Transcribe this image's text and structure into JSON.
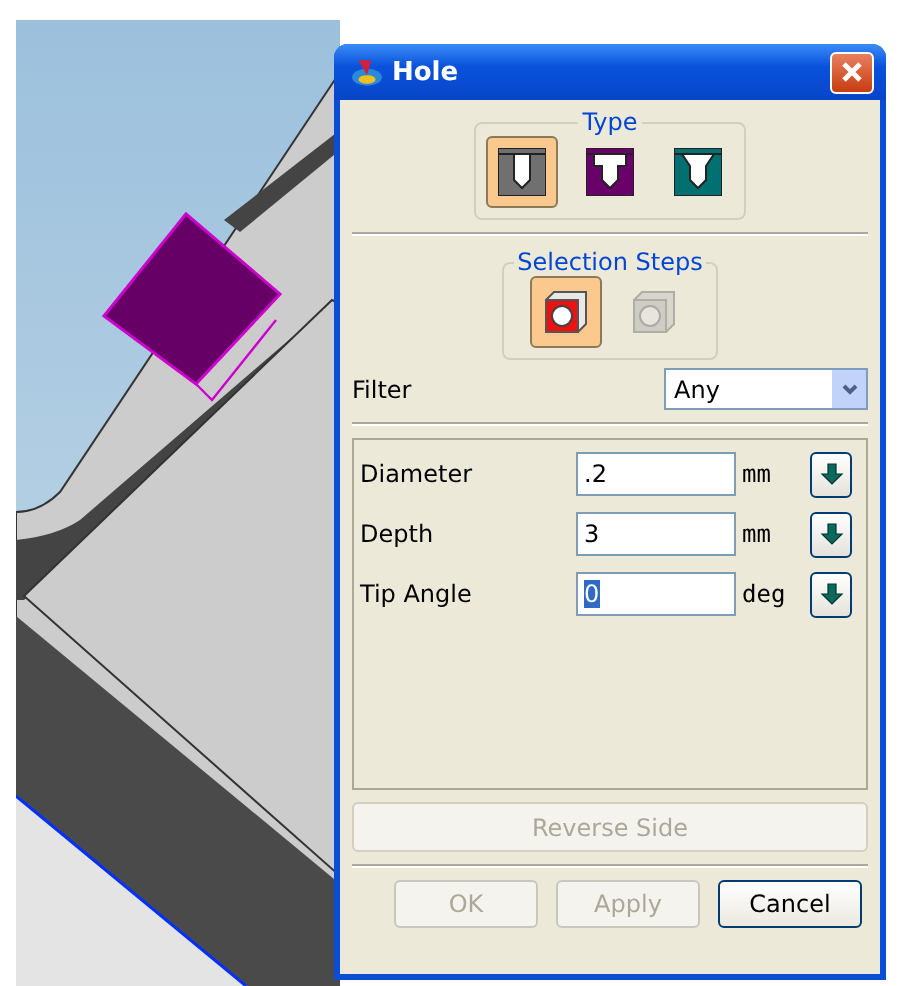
{
  "window": {
    "title": "Hole"
  },
  "type_group": {
    "label": "Type",
    "options": [
      {
        "kind": "simple",
        "selected": true
      },
      {
        "kind": "counterbore",
        "selected": false
      },
      {
        "kind": "countersink",
        "selected": false
      }
    ]
  },
  "selection_steps": {
    "label": "Selection Steps",
    "steps": [
      {
        "selected": true,
        "disabled": false
      },
      {
        "selected": false,
        "disabled": true
      }
    ]
  },
  "filter": {
    "label": "Filter",
    "value": "Any"
  },
  "parameters": [
    {
      "label": "Diameter",
      "value": ".2",
      "unit": "mm",
      "highlighted": false
    },
    {
      "label": "Depth",
      "value": "3",
      "unit": "mm",
      "highlighted": false
    },
    {
      "label": "Tip Angle",
      "value": "0",
      "unit": "deg",
      "highlighted": true
    }
  ],
  "reverse_side": {
    "label": "Reverse Side",
    "disabled": true
  },
  "buttons": [
    {
      "label": "OK",
      "disabled": true
    },
    {
      "label": "Apply",
      "disabled": true
    },
    {
      "label": "Cancel",
      "disabled": false
    }
  ]
}
